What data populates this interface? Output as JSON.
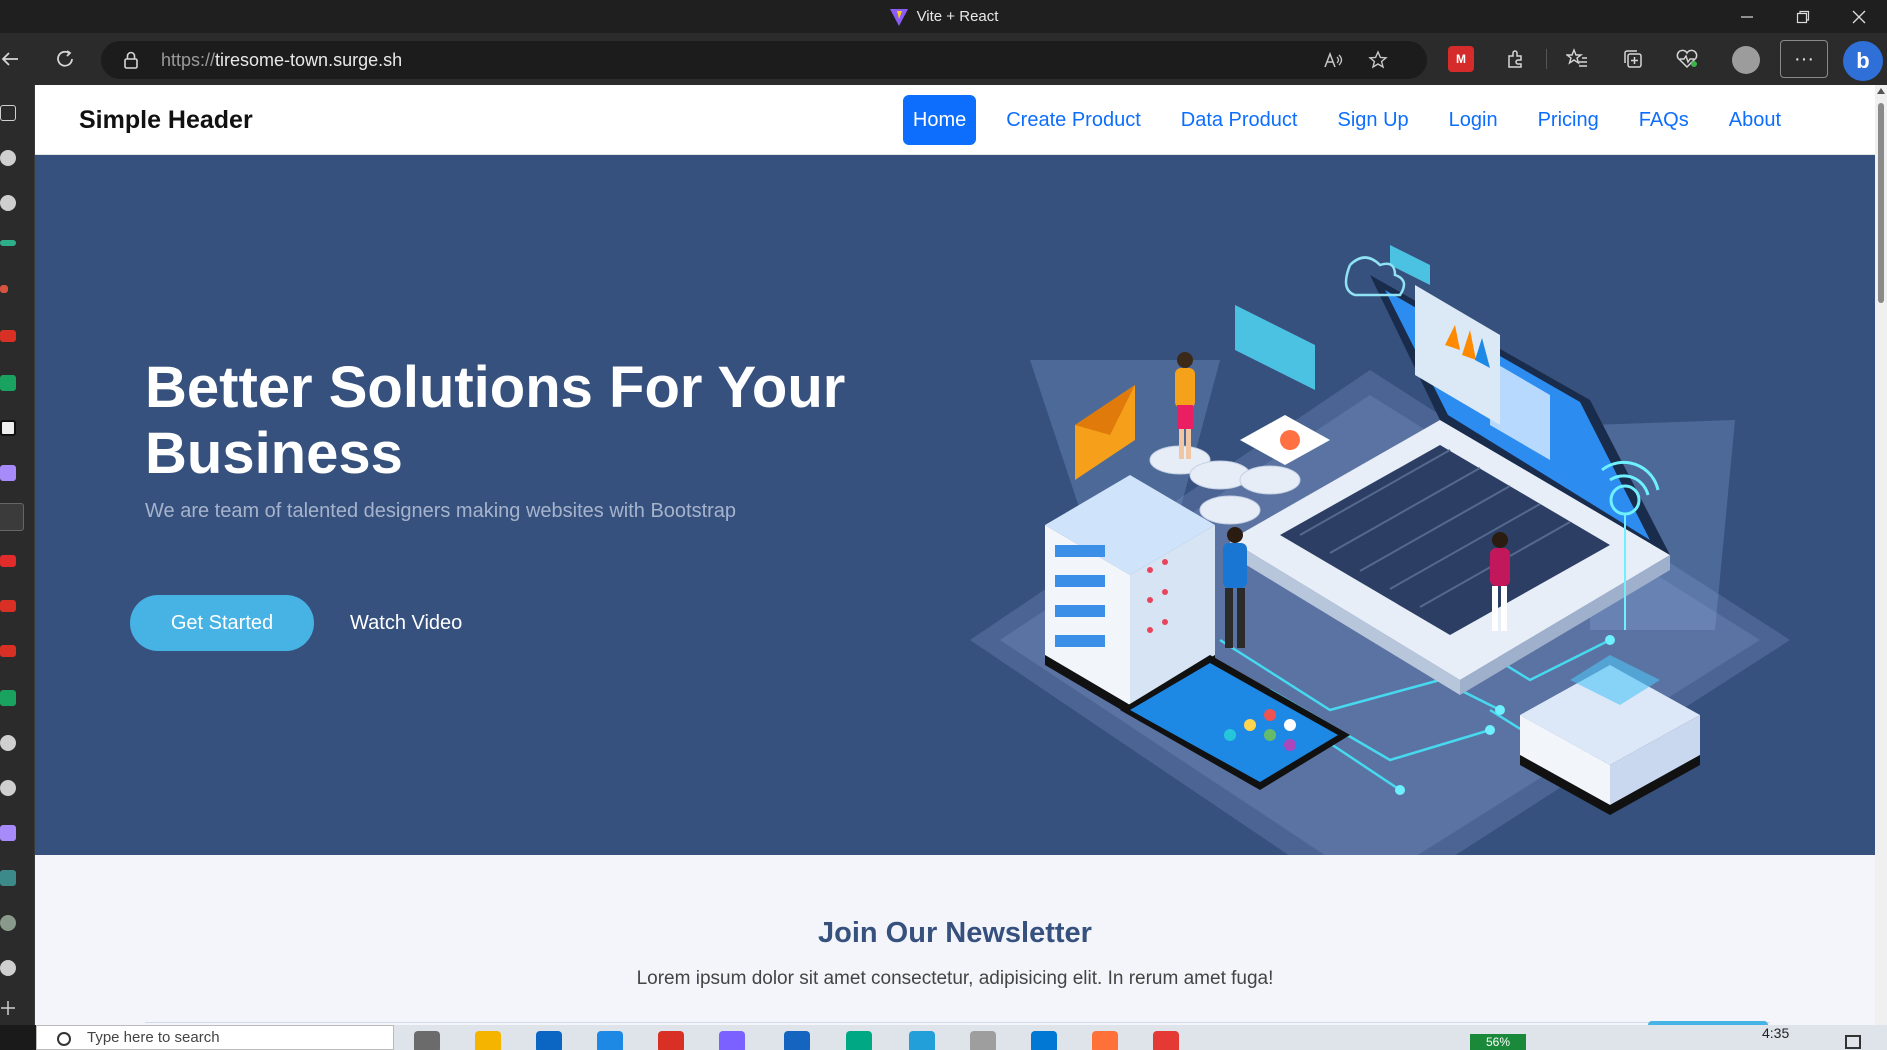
{
  "window": {
    "title": "Vite + React",
    "controls": [
      "minimize",
      "restore",
      "close"
    ]
  },
  "browser": {
    "url_scheme": "https://",
    "url_host": "tiresome-town.surge.sh",
    "more_label": "···",
    "bing_label": "b",
    "ext_label": "M"
  },
  "navbar": {
    "brand": "Simple Header",
    "links": [
      {
        "label": "Home",
        "active": true
      },
      {
        "label": "Create Product",
        "active": false
      },
      {
        "label": "Data Product",
        "active": false
      },
      {
        "label": "Sign Up",
        "active": false
      },
      {
        "label": "Login",
        "active": false
      },
      {
        "label": "Pricing",
        "active": false
      },
      {
        "label": "FAQs",
        "active": false
      },
      {
        "label": "About",
        "active": false
      }
    ]
  },
  "hero": {
    "heading": "Better Solutions For Your Business",
    "subtitle": "We are team of talented designers making websites with Bootstrap",
    "primary_button": "Get Started",
    "secondary_button": "Watch Video",
    "illustration": "isometric-laptop-servers-illustration"
  },
  "newsletter": {
    "heading": "Join Our Newsletter",
    "text": "Lorem ipsum dolor sit amet consectetur, adipisicing elit. In rerum amet fuga!"
  },
  "taskbar": {
    "search_placeholder": "Type here to search",
    "battery": "56%",
    "time": "4:35"
  },
  "colors": {
    "hero_bg": "#37517e",
    "accent": "#47b2e4",
    "nav_active": "#0d6efd",
    "newsletter_heading": "#37517e"
  }
}
